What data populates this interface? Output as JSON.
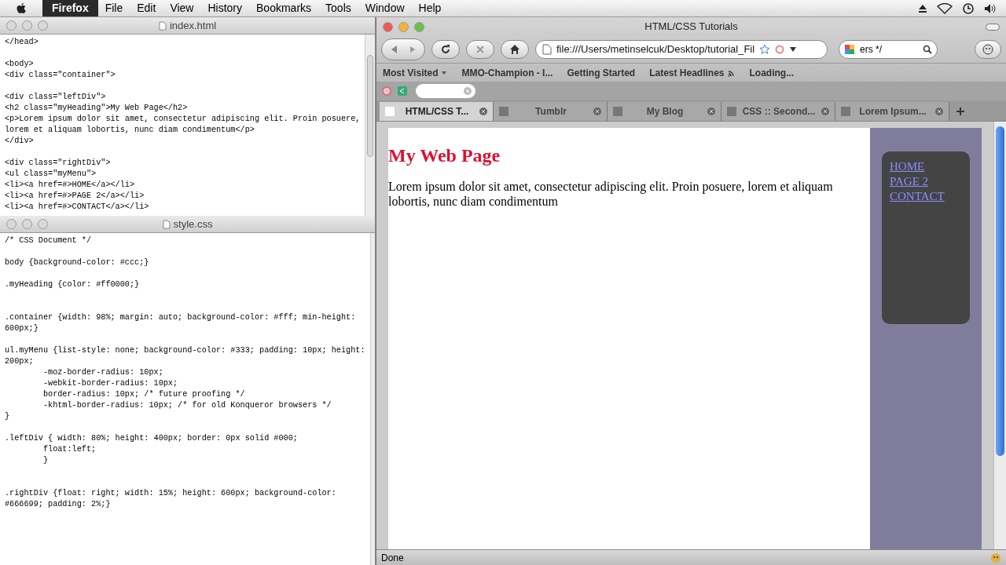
{
  "menu_bar": {
    "app_name": "Firefox",
    "menus": [
      "File",
      "Edit",
      "View",
      "History",
      "Bookmarks",
      "Tools",
      "Window",
      "Help"
    ]
  },
  "editors": [
    {
      "title": "index.html",
      "lines": [
        {
          "kind": "code",
          "text": "</head>"
        },
        {
          "kind": "blank"
        },
        {
          "kind": "code",
          "text": "<body>"
        },
        {
          "kind": "code",
          "text": "<div class=\"container\">"
        },
        {
          "kind": "blank"
        },
        {
          "kind": "code",
          "text": "<div class=\"leftDiv\">"
        },
        {
          "kind": "code",
          "text": "<h2 class=\"myHeading\">My Web Page</h2>"
        },
        {
          "kind": "code",
          "text": "<p>Lorem ipsum dolor sit amet, consectetur adipiscing elit. Proin posuere,"
        },
        {
          "kind": "code",
          "text": "lorem et aliquam lobortis, nunc diam condimentum</p>"
        },
        {
          "kind": "code",
          "text": "</div>"
        },
        {
          "kind": "blank"
        },
        {
          "kind": "code",
          "text": "<div class=\"rightDiv\">"
        },
        {
          "kind": "code",
          "text": "<ul class=\"myMenu\">"
        },
        {
          "kind": "code",
          "text": "<li><a href=#>HOME</a></li>"
        },
        {
          "kind": "code",
          "text": "<li><a href=#>PAGE 2</a></li>"
        },
        {
          "kind": "code",
          "text": "<li><a href=#>CONTACT</a></li>"
        }
      ]
    },
    {
      "title": "style.css",
      "lines": [
        {
          "kind": "code",
          "text": "/* CSS Document */"
        },
        {
          "kind": "blank"
        },
        {
          "kind": "code",
          "text": "body {background-color: #ccc;}"
        },
        {
          "kind": "blank"
        },
        {
          "kind": "code",
          "text": ".myHeading {color: #ff0000;}"
        },
        {
          "kind": "blank"
        },
        {
          "kind": "blank"
        },
        {
          "kind": "code",
          "text": ".container {width: 98%; margin: auto; background-color: #fff; min-height:"
        },
        {
          "kind": "code",
          "text": "600px;}"
        },
        {
          "kind": "blank"
        },
        {
          "kind": "code",
          "text": "ul.myMenu {list-style: none; background-color: #333; padding: 10px; height:"
        },
        {
          "kind": "code",
          "text": "200px;"
        },
        {
          "kind": "code",
          "text": "        -moz-border-radius: 10px;"
        },
        {
          "kind": "code",
          "text": "        -webkit-border-radius: 10px;"
        },
        {
          "kind": "code",
          "text": "        border-radius: 10px; /* future proofing */"
        },
        {
          "kind": "code",
          "text": "        -khtml-border-radius: 10px; /* for old Konqueror browsers */"
        },
        {
          "kind": "code",
          "text": "}"
        },
        {
          "kind": "blank"
        },
        {
          "kind": "code",
          "text": ".leftDiv { width: 80%; height: 400px; border: 0px solid #000;"
        },
        {
          "kind": "code",
          "text": "        float:left;"
        },
        {
          "kind": "code",
          "text": "        }"
        },
        {
          "kind": "blank"
        },
        {
          "kind": "blank"
        },
        {
          "kind": "code",
          "text": ".rightDiv {float: right; width: 15%; height: 600px; background-color:"
        },
        {
          "kind": "code",
          "text": "#666699; padding: 2%;}"
        }
      ]
    }
  ],
  "browser": {
    "title": "HTML/CSS Tutorials",
    "url": "file:///Users/metinselcuk/Desktop/tutorial_Fil",
    "search_value": "ers */",
    "bookmarks": [
      {
        "label": "Most Visited",
        "kind": "menu"
      },
      {
        "label": "MMO-Champion - I...",
        "kind": "link"
      },
      {
        "label": "Getting Started",
        "kind": "link"
      },
      {
        "label": "Latest Headlines",
        "kind": "feed"
      },
      {
        "label": "Loading...",
        "kind": "link"
      }
    ],
    "tabs": [
      {
        "label": "HTML/CSS T...",
        "selected": true
      },
      {
        "label": "Tumblr",
        "selected": false
      },
      {
        "label": "My Blog",
        "selected": false
      },
      {
        "label": "CSS :: Second...",
        "selected": false
      },
      {
        "label": "Lorem Ipsum...",
        "selected": false
      }
    ],
    "page": {
      "heading": "My Web Page",
      "paragraph": "Lorem ipsum dolor sit amet, consectetur adipiscing elit. Proin posuere, lorem et aliquam lobortis, nunc diam condimentum",
      "menu_links": [
        "HOME",
        "PAGE 2",
        "CONTACT"
      ]
    },
    "status": "Done"
  }
}
